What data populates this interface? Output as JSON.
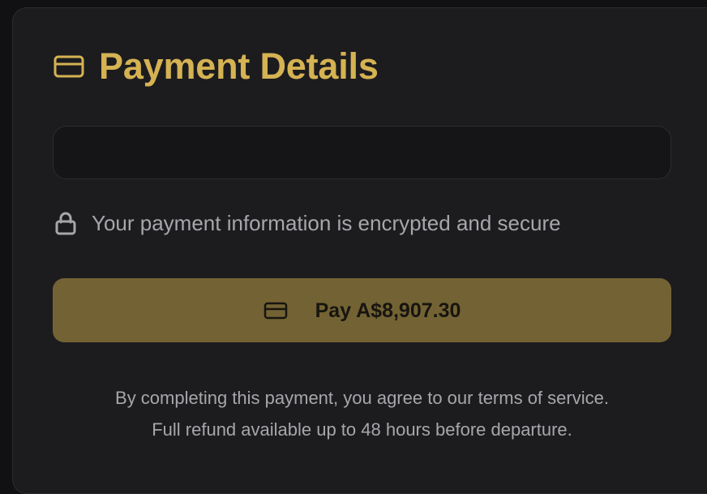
{
  "colors": {
    "accent": "#d5b252",
    "pay_button_bg": "#736334",
    "pay_button_text": "#17150f",
    "muted_text": "#a7a7ab",
    "card_bg": "#1c1c1f"
  },
  "header": {
    "icon": "credit-card-icon",
    "title": "Payment Details"
  },
  "card_field": {
    "value": ""
  },
  "security_note": {
    "icon": "lock-icon",
    "text": "Your payment information is encrypted and secure"
  },
  "pay_button": {
    "icon": "credit-card-icon",
    "label": "Pay A$8,907.30"
  },
  "terms": {
    "line1": "By completing this payment, you agree to our terms of service.",
    "line2": "Full refund available up to 48 hours before departure."
  }
}
